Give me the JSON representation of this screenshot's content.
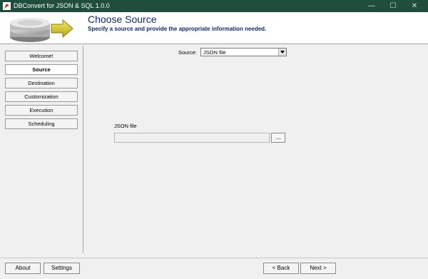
{
  "window": {
    "title": "DBConvert for JSON & SQL 1.0.0",
    "title_bg": "#1f4e3d",
    "minimize_glyph": "—",
    "maximize_glyph": "☐",
    "close_glyph": "✕"
  },
  "header": {
    "title": "Choose Source",
    "subtitle": "Specify a source and provide the appropriate information needed.",
    "accent_color": "#0a2a6e"
  },
  "sidebar": {
    "items": [
      {
        "label": "Welcome!",
        "active": false
      },
      {
        "label": "Source",
        "active": true
      },
      {
        "label": "Destination",
        "active": false
      },
      {
        "label": "Customization",
        "active": false
      },
      {
        "label": "Execution",
        "active": false
      },
      {
        "label": "Scheduling",
        "active": false
      }
    ]
  },
  "source": {
    "label": "Source:",
    "selected": "JSON file"
  },
  "file": {
    "label": "JSON file",
    "value": "",
    "browse_label": "..."
  },
  "footer": {
    "about": "About",
    "settings": "Settings",
    "back": "< Back",
    "next": "Next >"
  }
}
